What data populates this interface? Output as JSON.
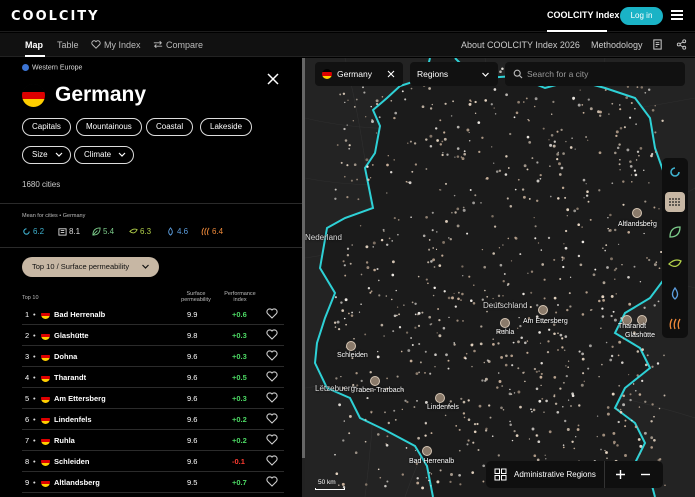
{
  "header": {
    "logo": "COOLCITY",
    "index_link": "COOLCITY Index",
    "login_label": "Log in"
  },
  "subnav": {
    "tabs": [
      {
        "label": "Map",
        "active": true
      },
      {
        "label": "Table",
        "active": false
      },
      {
        "label": "My Index",
        "active": false
      },
      {
        "label": "Compare",
        "active": false
      }
    ],
    "about": "About COOLCITY Index 2026",
    "methodology": "Methodology"
  },
  "panel": {
    "region": "Western Europe",
    "country": "Germany",
    "tags": [
      "Capitals",
      "Mountainous",
      "Coastal",
      "Lakeside"
    ],
    "filters": [
      "Size",
      "Climate"
    ],
    "cities_count": "1680 cities",
    "means_label": "Mean for cities • Germany",
    "metrics": [
      {
        "icon": "refresh-icon",
        "value": "6.2",
        "color": "#3fb3d0"
      },
      {
        "icon": "building-icon",
        "value": "8.1",
        "color": "#dddddd"
      },
      {
        "icon": "leaf-icon",
        "value": "5.4",
        "color": "#7ccc8a"
      },
      {
        "icon": "wind-leaf-icon",
        "value": "6.3",
        "color": "#b3d24a"
      },
      {
        "icon": "water-drop-icon",
        "value": "4.6",
        "color": "#5d9fe0"
      },
      {
        "icon": "heat-icon",
        "value": "6.4",
        "color": "#f08a3a"
      }
    ],
    "sort_dropdown": "Top 10 / Surface permeability",
    "table_headers": {
      "top": "Top 10",
      "permeability": [
        "Surface",
        "permeability"
      ],
      "performance": [
        "Performance",
        "index"
      ]
    },
    "rows": [
      {
        "rank": "1",
        "city": "Bad Herrenalb",
        "perm": "9.9",
        "perf": "+0.6",
        "positive": true
      },
      {
        "rank": "2",
        "city": "Glashütte",
        "perm": "9.8",
        "perf": "+0.3",
        "positive": true
      },
      {
        "rank": "3",
        "city": "Dohna",
        "perm": "9.6",
        "perf": "+0.3",
        "positive": true
      },
      {
        "rank": "4",
        "city": "Tharandt",
        "perm": "9.6",
        "perf": "+0.5",
        "positive": true
      },
      {
        "rank": "5",
        "city": "Am Ettersberg",
        "perm": "9.6",
        "perf": "+0.3",
        "positive": true
      },
      {
        "rank": "6",
        "city": "Lindenfels",
        "perm": "9.6",
        "perf": "+0.2",
        "positive": true
      },
      {
        "rank": "7",
        "city": "Ruhla",
        "perm": "9.6",
        "perf": "+0.2",
        "positive": true
      },
      {
        "rank": "8",
        "city": "Schleiden",
        "perm": "9.6",
        "perf": "-0.1",
        "positive": false
      },
      {
        "rank": "9",
        "city": "Altlandsberg",
        "perm": "9.5",
        "perf": "+0.7",
        "positive": true
      }
    ]
  },
  "map": {
    "country_chip": "Germany",
    "regions_select": "Regions",
    "search_placeholder": "Search for a city",
    "admin_regions_label": "Administrative Regions",
    "scale_label": "50 km",
    "labels": [
      {
        "text": "Altlandsberg",
        "kind": "city"
      },
      {
        "text": "Deutschland",
        "kind": "country"
      },
      {
        "text": "Am Ettersberg",
        "kind": "city"
      },
      {
        "text": "Ruhla",
        "kind": "city"
      },
      {
        "text": "Tharandt",
        "kind": "city"
      },
      {
        "text": "Glashütte",
        "kind": "city"
      },
      {
        "text": "Schleiden",
        "kind": "city"
      },
      {
        "text": "Traben-Trarbach",
        "kind": "city"
      },
      {
        "text": "Lindenfels",
        "kind": "city"
      },
      {
        "text": "Bad Herrenalb",
        "kind": "city"
      },
      {
        "text": "Nederland",
        "kind": "country"
      },
      {
        "text": "Lëtzebuerg",
        "kind": "country"
      }
    ]
  },
  "colors": {
    "accent": "#1ab3c6",
    "positive": "#4cd964",
    "negative": "#ff3b30",
    "border_line": "#2ed1d6",
    "dropdown_bg": "#c7b7a4"
  }
}
